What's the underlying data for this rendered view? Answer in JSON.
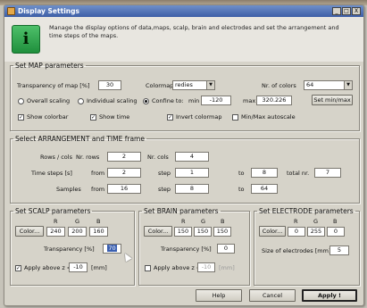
{
  "window": {
    "title": "Display Settings",
    "controls": [
      "_",
      "□",
      "X"
    ]
  },
  "info": {
    "text": "Manage the display options of data,maps, scalp, brain and electrodes and set the arrangement and time steps of the maps."
  },
  "map": {
    "legend": "Set MAP parameters",
    "transparency_label": "Transparency of map [%]",
    "transparency_value": "30",
    "colormap_label": "Colormap",
    "colormap_value": "redies",
    "ncolors_label": "Nr. of colors",
    "ncolors_value": "64",
    "overall_label": "Overall scaling",
    "individual_label": "Individual scaling",
    "confine_label": "Confine to:",
    "min_label": "min",
    "min_value": "-120",
    "max_label": "max",
    "max_value": "320.226",
    "set_minmax_label": "Set min/max",
    "show_colorbar_label": "Show colorbar",
    "show_time_label": "Show time",
    "invert_label": "Invert colormap",
    "autoscale_label": "Min/Max autoscale"
  },
  "arrangement": {
    "legend": "Select ARRANGEMENT and TIME frame",
    "rows_cols_label": "Rows / cols",
    "nrows_label": "Nr. rows",
    "nrows_value": "2",
    "ncols_label": "Nr. cols",
    "ncols_value": "4",
    "timesteps_label": "Time steps [s]",
    "from_label": "from",
    "from_value": "2",
    "step_label": "step",
    "step_value": "1",
    "to_label": "to",
    "to_value": "8",
    "total_label": "total nr.",
    "total_value": "7",
    "samples_label": "Samples",
    "s_from_label": "from",
    "s_from_value": "16",
    "s_step_label": "step",
    "s_step_value": "8",
    "s_to_label": "to",
    "s_to_value": "64"
  },
  "scalp": {
    "legend": "Set SCALP parameters",
    "r_label": "R",
    "g_label": "G",
    "b_label": "B",
    "color_btn": "Color...",
    "r": "240",
    "g": "200",
    "b": "160",
    "transparency_label": "Transparency [%]",
    "transparency_value": "70",
    "apply_label": "Apply above z =",
    "apply_value": "-10",
    "unit": "[mm]"
  },
  "brain": {
    "legend": "Set BRAIN parameters",
    "r_label": "R",
    "g_label": "G",
    "b_label": "B",
    "color_btn": "Color...",
    "r": "150",
    "g": "150",
    "b": "150",
    "transparency_label": "Transparency [%]",
    "transparency_value": "0",
    "apply_label": "Apply above z =",
    "apply_value": "-10",
    "unit": "[mm]"
  },
  "electrode": {
    "legend": "Set ELECTRODE parameters",
    "r_label": "R",
    "g_label": "G",
    "b_label": "B",
    "color_btn": "Color...",
    "r": "0",
    "g": "255",
    "b": "0",
    "size_label": "Size of electrodes [mm]",
    "size_value": "5"
  },
  "buttons": {
    "help": "Help",
    "cancel": "Cancel",
    "apply": "Apply !"
  }
}
